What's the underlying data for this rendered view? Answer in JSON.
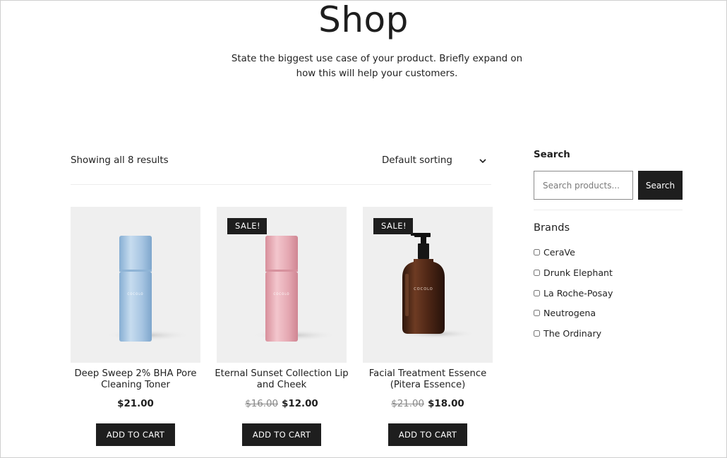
{
  "page": {
    "title": "Shop",
    "subtitle": "State the biggest use case of your product. Briefly expand on how this will help your customers."
  },
  "toolbar": {
    "result_count": "Showing all 8 results",
    "sorting_label": "Default sorting"
  },
  "products": [
    {
      "name": "Deep Sweep 2% BHA Pore Cleaning Toner",
      "price": "$21.00",
      "old_price": "",
      "sale_badge": "",
      "button": "ADD TO CART",
      "bottle_color": "#a8c8e4"
    },
    {
      "name": "Eternal Sunset Collection Lip and Cheek",
      "price": "$12.00",
      "old_price": "$16.00",
      "sale_badge": "SALE!",
      "button": "ADD TO CART",
      "bottle_color": "#e9aeb6"
    },
    {
      "name": "Facial Treatment Essence (Pitera Essence)",
      "price": "$18.00",
      "old_price": "$21.00",
      "sale_badge": "SALE!",
      "button": "ADD TO CART",
      "bottle_color": "#5a2e1c"
    }
  ],
  "sidebar": {
    "search_heading": "Search",
    "search_placeholder": "Search products...",
    "search_button": "Search",
    "brands_heading": "Brands",
    "brands": [
      "CeraVe",
      "Drunk Elephant",
      "La Roche-Posay",
      "Neutrogena",
      "The Ordinary"
    ]
  },
  "colors": {
    "button_bg": "#1e1e1e",
    "image_bg": "#efefef"
  }
}
